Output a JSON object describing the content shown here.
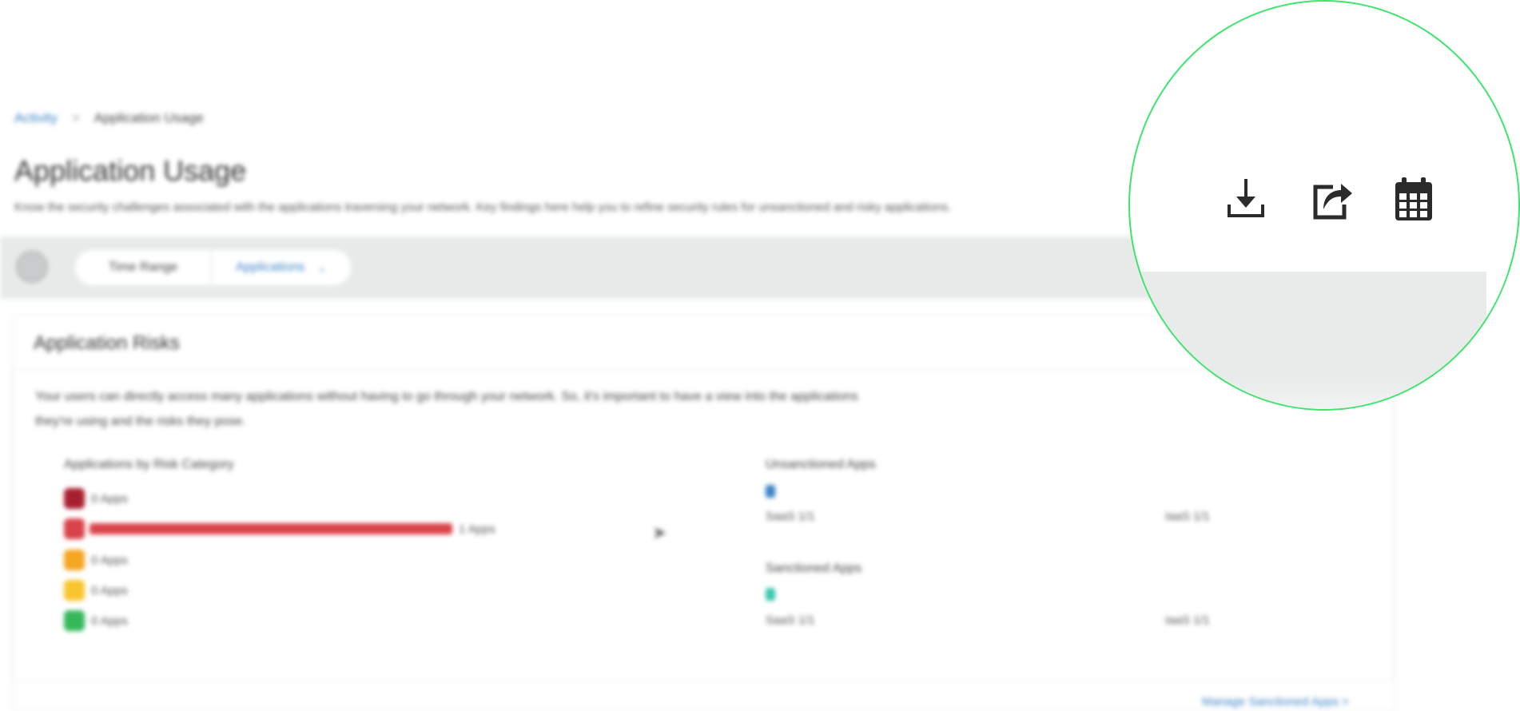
{
  "breadcrumb": {
    "parent": "Activity",
    "separator": ">",
    "current": "Application Usage"
  },
  "page": {
    "title": "Application Usage",
    "description": "Know the security challenges associated with the applications traversing your network. Key findings here help you to refine security rules for unsanctioned and risky applications."
  },
  "toolbar": {
    "time_range": "Time Range",
    "applications": "Applications"
  },
  "card": {
    "title": "Application Risks",
    "description_line1": "Your users can directly access many applications without having to go through your network. So, it's important to have a view into the applications",
    "description_line2": "they're using and the risks they pose."
  },
  "risk_chart": {
    "title": "Applications by Risk Category",
    "categories": [
      {
        "label": "0 Apps",
        "value": 0,
        "color": "#a8202f"
      },
      {
        "label": "1 Apps",
        "value": 1,
        "color": "#d9434b"
      },
      {
        "label": "0 Apps",
        "value": 0,
        "color": "#f5a623"
      },
      {
        "label": "0 Apps",
        "value": 0,
        "color": "#f8c52e"
      },
      {
        "label": "0 Apps",
        "value": 0,
        "color": "#34b85a"
      }
    ],
    "max": 1
  },
  "unsanctioned": {
    "title": "Unsanctioned Apps",
    "color": "#3b82c4",
    "left_text": "SaaS 1/1",
    "right_text": "IaaS 1/1"
  },
  "sanctioned": {
    "title": "Sanctioned Apps",
    "color": "#3cc7b0",
    "left_text": "SaaS 1/1",
    "right_text": "IaaS 1/1"
  },
  "manage_link": "Manage Sanctioned Apps >",
  "icons": {
    "filter": "filter-icon",
    "download": "download-icon",
    "share": "share-icon",
    "schedule": "calendar-icon"
  },
  "colors": {
    "accent": "#3b82c4",
    "magnifier_border": "#3ee46c",
    "icon": "#2b2b2b"
  }
}
